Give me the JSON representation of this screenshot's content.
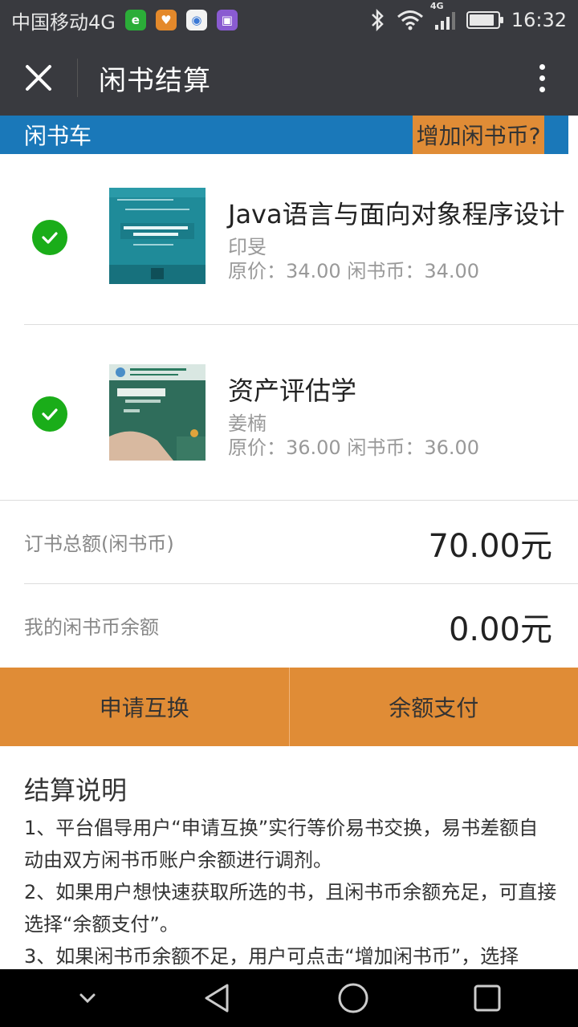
{
  "status_bar": {
    "carrier": "中国移动4G",
    "network": "4G",
    "time": "16:32",
    "battery_level": 0.9,
    "icons": [
      "wechat-icon",
      "health-icon",
      "chrome-icon",
      "gallery-icon",
      "bluetooth-icon",
      "wifi-icon",
      "signal-icon",
      "battery-icon"
    ]
  },
  "title_bar": {
    "title": "闲书结算",
    "close_icon": "close-icon",
    "more_icon": "more-vertical-icon"
  },
  "cart": {
    "label": "闲书车",
    "add_coin": "增加闲书币?"
  },
  "books": [
    {
      "title": "Java语言与面向对象程序设计",
      "author": "印旻",
      "price": "原价：34.00 闲书币：34.00",
      "cover_color": "#1e8a98",
      "checked": true
    },
    {
      "title": "资产评估学",
      "author": "姜楠",
      "price": "原价：36.00 闲书币：36.00",
      "cover_color": "#2e6e5a",
      "checked": true
    }
  ],
  "totals": {
    "order_label": "订书总额(闲书币)",
    "order_value": "70.00元",
    "balance_label": "我的闲书币余额",
    "balance_value": "0.00元"
  },
  "actions": {
    "exchange": "申请互换",
    "pay": "余额支付"
  },
  "notes": {
    "heading": "结算说明",
    "items": [
      "1、平台倡导用户“申请互换”实行等价易书交换，易书差额自动由双方闲书币账户余额进行调剂。",
      "2、如果用户想快速获取所选的书，且闲书币余额充足，可直接选择“余额支付”。",
      "3、如果闲书币余额不足，用户可点击“增加闲书币”，选择"
    ]
  },
  "colors": {
    "header_dark": "#393a3f",
    "cart_blue": "#1a78b9",
    "accent_orange": "#e08c36",
    "check_green": "#1aad19"
  }
}
